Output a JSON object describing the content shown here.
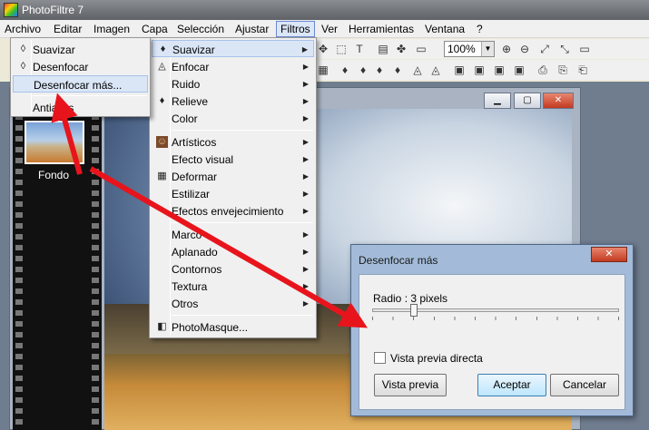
{
  "window": {
    "title": "PhotoFiltre 7"
  },
  "menubar": {
    "items": [
      "Archivo",
      "Editar",
      "Imagen",
      "Capa",
      "Selección",
      "Ajustar",
      "Filtros",
      "Ver",
      "Herramientas",
      "Ventana",
      "?"
    ],
    "active": "Filtros"
  },
  "toolbar": {
    "zoom_value": "100%"
  },
  "filmstrip": {
    "layer_label": "Fondo"
  },
  "filter_menu": {
    "items": [
      {
        "label": "Suavizar",
        "icon": "drop-icon"
      },
      {
        "label": "Enfocar",
        "icon": "sharpen-drop-icon"
      },
      {
        "label": "Ruido",
        "icon": ""
      },
      {
        "label": "Relieve",
        "icon": "emboss-drop-icon"
      },
      {
        "label": "Color",
        "icon": ""
      },
      {
        "label": "Artísticos",
        "icon": "portrait-icon"
      },
      {
        "label": "Efecto visual",
        "icon": ""
      },
      {
        "label": "Deformar",
        "icon": "grid-icon"
      },
      {
        "label": "Estilizar",
        "icon": ""
      },
      {
        "label": "Efectos envejecimiento",
        "icon": ""
      },
      {
        "label": "Marco",
        "icon": ""
      },
      {
        "label": "Aplanado",
        "icon": ""
      },
      {
        "label": "Contornos",
        "icon": ""
      },
      {
        "label": "Textura",
        "icon": ""
      },
      {
        "label": "Otros",
        "icon": ""
      },
      {
        "label": "PhotoMasque...",
        "icon": "mask-icon"
      }
    ],
    "highlighted": "Suavizar"
  },
  "submenu": {
    "items": [
      {
        "label": "Suavizar",
        "icon": "drop-icon"
      },
      {
        "label": "Desenfocar",
        "icon": "drop-icon"
      },
      {
        "label": "Desenfocar más...",
        "icon": ""
      },
      {
        "label": "Antialias",
        "icon": ""
      }
    ],
    "highlighted": "Desenfocar más..."
  },
  "dialog": {
    "title": "Desenfocar más",
    "close_label": "✕",
    "radius_label": "Radio : 3 pixels",
    "radius_value": 3,
    "radius_fraction": 0.17,
    "preview_checkbox_label": "Vista previa directa",
    "preview_checked": false,
    "preview_button": "Vista previa",
    "ok_button": "Aceptar",
    "cancel_button": "Cancelar"
  },
  "colors": {
    "annotation_arrow": "#e8141c",
    "highlight": "#dae6f6",
    "dialog_frame": "#a3bbd8"
  }
}
